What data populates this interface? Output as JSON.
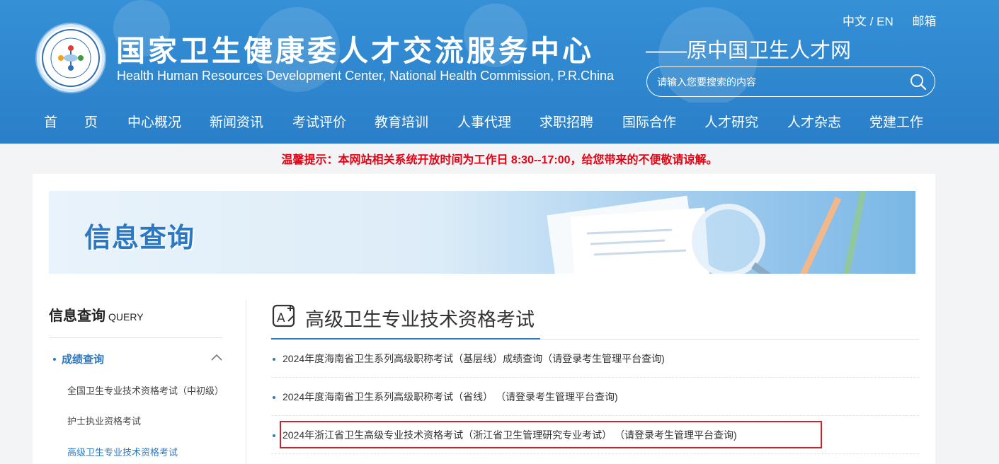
{
  "header": {
    "title": "国家卫生健康委人才交流服务中心",
    "subtitle_en": "Health Human Resources Development Center, National Health Commission, P.R.China",
    "slogan": "——原中国卫生人才网",
    "lang_switch": "中文 / EN",
    "mail_link": "邮箱",
    "search_placeholder": "请输入您要搜索的内容",
    "logo_icon": "organization-seal-logo",
    "search_icon": "magnifier-icon"
  },
  "nav": {
    "items": [
      "首　　页",
      "中心概况",
      "新闻资讯",
      "考试评价",
      "教育培训",
      "人事代理",
      "求职招聘",
      "国际合作",
      "人才研究",
      "人才杂志",
      "党建工作"
    ]
  },
  "notice": "温馨提示：本网站相关系统开放时间为工作日 8:30--17:00，给您带来的不便敬请谅解。",
  "banner": {
    "title": "信息查询"
  },
  "sidebar": {
    "title": "信息查询",
    "title_en": "QUERY",
    "active_group": "成绩查询",
    "sub_items": [
      {
        "label": "全国卫生专业技术资格考试（中初级）",
        "active": false
      },
      {
        "label": "护士执业资格考试",
        "active": false
      },
      {
        "label": "高级卫生专业技术资格考试",
        "active": true
      }
    ]
  },
  "main": {
    "section_title": "高级卫生专业技术资格考试",
    "items": [
      "2024年度海南省卫生系列高级职称考试（基层线）成绩查询（请登录考生管理平台查询)",
      "2024年度海南省卫生系列高级职称考试（省线） （请登录考生管理平台查询)",
      "2024年浙江省卫生高级专业技术资格考试（浙江省卫生管理研究专业考试） （请登录考生管理平台查询)"
    ]
  },
  "colors": {
    "header_blue": "#2f86cf",
    "accent_blue": "#2d78c2",
    "notice_red": "#e60012",
    "highlight_red": "#c8262d"
  }
}
